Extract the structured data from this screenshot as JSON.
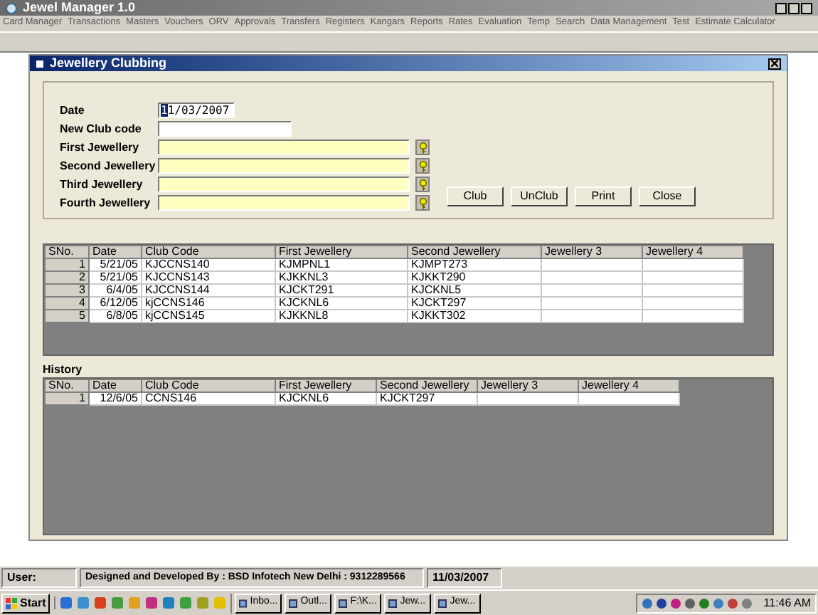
{
  "app": {
    "title": "Jewel Manager 1.0"
  },
  "menu": [
    "Card Manager",
    "Transactions",
    "Masters",
    "Vouchers",
    "ORV",
    "Approvals",
    "Transfers",
    "Registers",
    "Kangars",
    "Reports",
    "Rates",
    "Evaluation",
    "Temp",
    "Search",
    "Data Management",
    "Test",
    "Estimate Calculator"
  ],
  "dialog": {
    "title": "Jewellery Clubbing",
    "fields": [
      {
        "kind": "date",
        "label": "Date",
        "value": "11/03/2007"
      },
      {
        "kind": "text",
        "label": "New Club code"
      },
      {
        "kind": "lookup",
        "label": "First Jewellery"
      },
      {
        "kind": "lookup",
        "label": "Second Jewellery"
      },
      {
        "kind": "lookup",
        "label": "Third Jewellery"
      },
      {
        "kind": "lookup",
        "label": "Fourth Jewellery"
      }
    ],
    "buttons": [
      "Club",
      "UnClub",
      "Print",
      "Close"
    ],
    "table": {
      "columns": [
        "SNo.",
        "Date",
        "Club Code",
        "First Jewellery",
        "Second Jewellery",
        "Jewellery 3",
        "Jewellery 4"
      ],
      "rows": [
        [
          "1",
          "5/21/05",
          "KJCCNS140",
          "KJMPNL1",
          "KJMPT273",
          null,
          null
        ],
        [
          "2",
          "5/21/05",
          "KJCCNS143",
          "KJKKNL3",
          "KJKKT290",
          null,
          null
        ],
        [
          "3",
          "6/4/05",
          "KJCCNS144",
          "KJCKT291",
          "KJCKNL5",
          null,
          null
        ],
        [
          "4",
          "6/12/05",
          "kjCCNS146",
          "KJCKNL6",
          "KJCKT297",
          null,
          null
        ],
        [
          "5",
          "6/8/05",
          "kjCCNS145",
          "KJKKNL8",
          "KJKKT302",
          null,
          null
        ]
      ]
    },
    "history": {
      "label": "History",
      "columns": [
        "SNo.",
        "Date",
        "Club Code",
        "First Jewellery",
        "Second Jewellery",
        "Jewellery 3",
        "Jewellery 4"
      ],
      "rows": [
        [
          "1",
          "12/6/05",
          "CCNS146",
          "KJCKNL6",
          "KJCKT297",
          null,
          null
        ]
      ]
    }
  },
  "status_bar": {
    "user": "User:",
    "credit": "Designed and Developed By : BSD Infotech New Delhi : 9312289566",
    "date": "11/03/2007"
  },
  "taskbar": {
    "start": "Start",
    "tasks": [
      "Inbo...",
      "Outl...",
      "F:\\K...",
      "Jew...",
      "Jew..."
    ],
    "clock": "11:46 AM"
  }
}
